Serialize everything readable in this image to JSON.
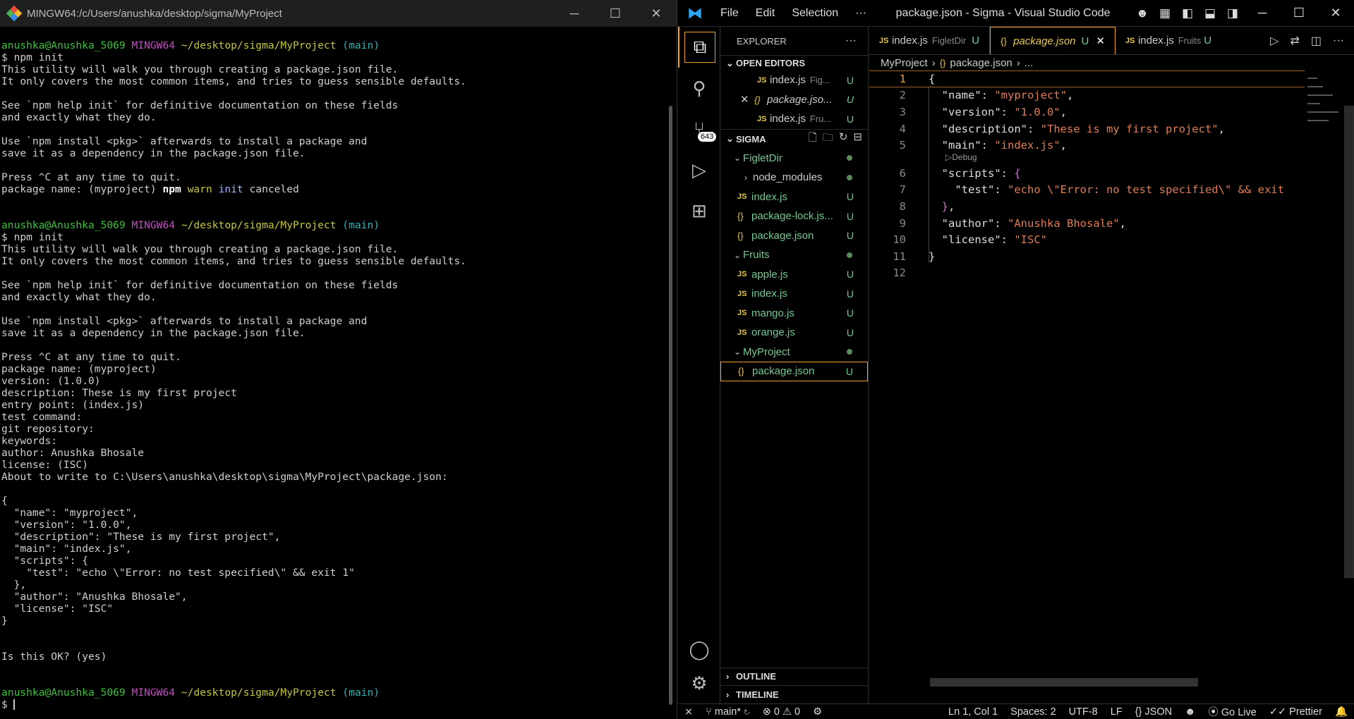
{
  "terminal": {
    "title": "MINGW64:/c/Users/anushka/desktop/sigma/MyProject",
    "prompt": {
      "user": "anushka@Anushka_5069",
      "env": "MINGW64",
      "path": "~/desktop/sigma/MyProject",
      "branch": "(main)",
      "symbol": "$"
    },
    "session1": {
      "command": "$ npm init",
      "intro": [
        "This utility will walk you through creating a package.json file.",
        "It only covers the most common items, and tries to guess sensible defaults.",
        "",
        "See `npm help init` for definitive documentation on these fields",
        "and exactly what they do.",
        "",
        "Use `npm install <pkg>` afterwards to install a package and",
        "save it as a dependency in the package.json file.",
        "",
        "Press ^C at any time to quit."
      ],
      "cancel_prefix": "package name: (myproject) ",
      "cancel_npm": "npm",
      "cancel_warn": "warn",
      "cancel_init": "init",
      "cancel_text": "canceled"
    },
    "session2": {
      "command": "$ npm init",
      "lines": [
        "This utility will walk you through creating a package.json file.",
        "It only covers the most common items, and tries to guess sensible defaults.",
        "",
        "See `npm help init` for definitive documentation on these fields",
        "and exactly what they do.",
        "",
        "Use `npm install <pkg>` afterwards to install a package and",
        "save it as a dependency in the package.json file.",
        "",
        "Press ^C at any time to quit.",
        "package name: (myproject)",
        "version: (1.0.0)",
        "description: These is my first project",
        "entry point: (index.js)",
        "test command:",
        "git repository:",
        "keywords:",
        "author: Anushka Bhosale",
        "license: (ISC)",
        "About to write to C:\\Users\\anushka\\desktop\\sigma\\MyProject\\package.json:",
        "",
        "{",
        "  \"name\": \"myproject\",",
        "  \"version\": \"1.0.0\",",
        "  \"description\": \"These is my first project\",",
        "  \"main\": \"index.js\",",
        "  \"scripts\": {",
        "    \"test\": \"echo \\\"Error: no test specified\\\" && exit 1\"",
        "  },",
        "  \"author\": \"Anushka Bhosale\",",
        "  \"license\": \"ISC\"",
        "}",
        "",
        "",
        "Is this OK? (yes)"
      ]
    },
    "final_prompt": "$"
  },
  "vscode": {
    "window_title": "package.json - Sigma - Visual Studio Code",
    "menu": [
      "File",
      "Edit",
      "Selection",
      "···"
    ],
    "scm_badge": "643",
    "explorer": {
      "header": "EXPLORER",
      "more": "···",
      "open_editors_label": "OPEN EDITORS",
      "open_editors": [
        {
          "name": "index.js",
          "folder": "Fig...",
          "status": "U"
        },
        {
          "name": "package.jso...",
          "folder": "",
          "status": "U"
        },
        {
          "name": "index.js",
          "folder": "Fru...",
          "status": "U"
        }
      ],
      "workspace_label": "SIGMA",
      "folders": [
        {
          "name": "FigletDir",
          "children": [
            {
              "name": "node_modules",
              "type": "folder",
              "status": ""
            },
            {
              "name": "index.js",
              "type": "js",
              "status": "U"
            },
            {
              "name": "package-lock.js...",
              "type": "json",
              "status": "U"
            },
            {
              "name": "package.json",
              "type": "json",
              "status": "U"
            }
          ]
        },
        {
          "name": "Fruits",
          "children": [
            {
              "name": "apple.js",
              "type": "js",
              "status": "U"
            },
            {
              "name": "index.js",
              "type": "js",
              "status": "U"
            },
            {
              "name": "mango.js",
              "type": "js",
              "status": "U"
            },
            {
              "name": "orange.js",
              "type": "js",
              "status": "U"
            }
          ]
        },
        {
          "name": "MyProject",
          "children": [
            {
              "name": "package.json",
              "type": "json",
              "status": "U"
            }
          ]
        }
      ],
      "outline_label": "OUTLINE",
      "timeline_label": "TIMELINE"
    },
    "tabs": [
      {
        "name": "index.js",
        "folder": "FigletDir",
        "status": "U"
      },
      {
        "name": "package.json",
        "folder": "",
        "status": "U"
      },
      {
        "name": "index.js",
        "folder": "Fruits",
        "status": "U"
      }
    ],
    "breadcrumbs": [
      "MyProject",
      "package.json",
      "..."
    ],
    "code": {
      "codelens": "Debug",
      "lines": [
        "1",
        "2",
        "3",
        "4",
        "5",
        "6",
        "7",
        "8",
        "9",
        "10",
        "11",
        "12"
      ],
      "name_key": "\"name\"",
      "name_val": "\"myproject\"",
      "version_key": "\"version\"",
      "version_val": "\"1.0.0\"",
      "description_key": "\"description\"",
      "description_val": "\"These is my first project\"",
      "main_key": "\"main\"",
      "main_val": "\"index.js\"",
      "scripts_key": "\"scripts\"",
      "test_key": "\"test\"",
      "test_val": "\"echo \\\"Error: no test specified\\\" && exit",
      "author_key": "\"author\"",
      "author_val": "\"Anushka Bhosale\"",
      "license_key": "\"license\"",
      "license_val": "\"ISC\""
    },
    "status": {
      "branch": "main*",
      "errors": "0",
      "warnings": "0",
      "position": "Ln 1, Col 1",
      "spaces": "Spaces: 2",
      "encoding": "UTF-8",
      "eol": "LF",
      "language": "JSON",
      "golive": "Go Live",
      "prettier": "Prettier"
    },
    "colors": {
      "accent": "#f0a030",
      "string": "#e07b55",
      "untracked": "#73c991"
    }
  }
}
